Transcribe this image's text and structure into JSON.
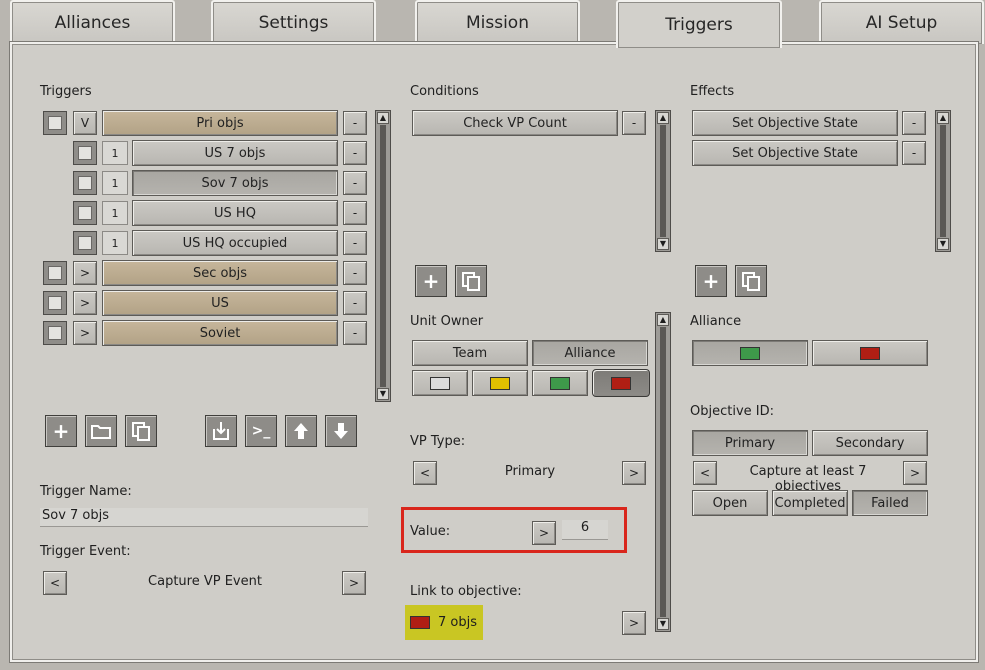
{
  "tabs": [
    "Alliances",
    "Settings",
    "Mission",
    "Triggers",
    "AI Setup"
  ],
  "triggers": {
    "header": "Triggers",
    "rows": [
      {
        "toggle": "V",
        "name": "Pri objs",
        "level": 0,
        "minus": "-"
      },
      {
        "count": "1",
        "name": "US 7 objs",
        "level": 1,
        "minus": "-"
      },
      {
        "count": "1",
        "name": "Sov 7 objs",
        "level": 1,
        "minus": "-"
      },
      {
        "count": "1",
        "name": "US HQ",
        "level": 1,
        "minus": "-"
      },
      {
        "count": "1",
        "name": "US HQ occupied",
        "level": 1,
        "minus": "-"
      },
      {
        "toggle": ">",
        "name": "Sec objs",
        "level": 0,
        "minus": "-"
      },
      {
        "toggle": ">",
        "name": "US",
        "level": 0,
        "minus": "-"
      },
      {
        "toggle": ">",
        "name": "Soviet",
        "level": 0,
        "minus": "-"
      }
    ],
    "trigger_name_label": "Trigger Name:",
    "trigger_name_value": "Sov 7 objs",
    "trigger_event_label": "Trigger Event:",
    "trigger_event_value": "Capture VP Event",
    "prev": "<",
    "next": ">"
  },
  "conditions": {
    "header": "Conditions",
    "items": [
      {
        "name": "Check VP Count",
        "minus": "-"
      }
    ],
    "unit_owner_label": "Unit Owner",
    "team_label": "Team",
    "alliance_label": "Alliance",
    "owner_colors": [
      "#dcdcdc",
      "#e2c000",
      "#3e9a4a",
      "#b01e14"
    ],
    "vp_type_label": "VP Type:",
    "vp_type_value": "Primary",
    "value_label": "Value:",
    "value": "6",
    "value_btn": ">",
    "link_label": "Link to objective:",
    "link_value": "7 objs",
    "link_color": "#b01e14",
    "prev": "<",
    "next": ">"
  },
  "effects": {
    "header": "Effects",
    "items": [
      {
        "name": "Set Objective State",
        "minus": "-"
      },
      {
        "name": "Set Objective State",
        "minus": "-"
      }
    ],
    "alliance_label": "Alliance",
    "alliance_colors": [
      "#3e9a4a",
      "#b01e14"
    ],
    "objective_id_label": "Objective ID:",
    "primary_label": "Primary",
    "secondary_label": "Secondary",
    "objective_value": "Capture at least 7 objectives",
    "states": [
      "Open",
      "Completed",
      "Failed"
    ],
    "prev": "<",
    "next": ">"
  },
  "colors": {
    "highlight_box": "#d9261c",
    "link_bg": "#c9c623"
  }
}
